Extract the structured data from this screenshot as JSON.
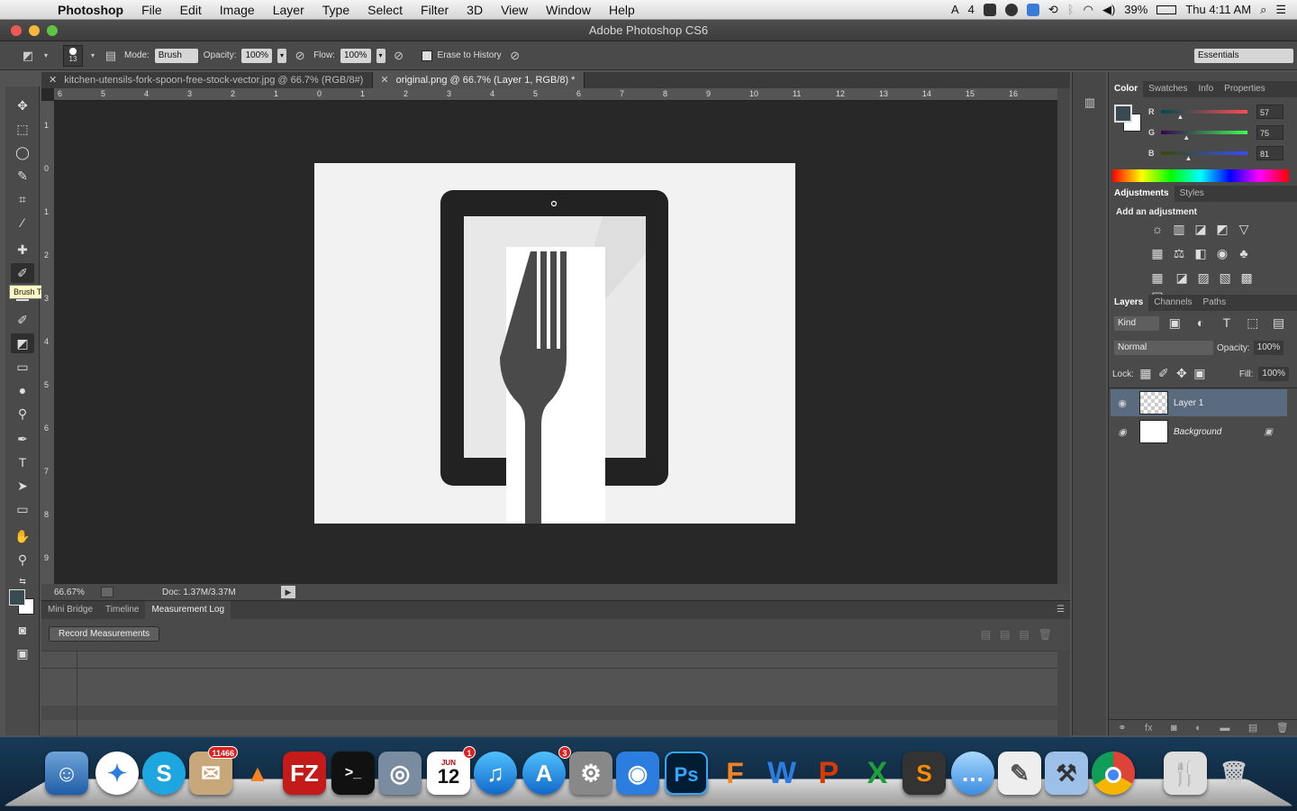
{
  "menubar": {
    "app": "Photoshop",
    "items": [
      "File",
      "Edit",
      "Image",
      "Layer",
      "Type",
      "Select",
      "Filter",
      "3D",
      "View",
      "Window",
      "Help"
    ],
    "status_count": "4",
    "battery": "39%",
    "clock": "Thu 4:11 AM"
  },
  "window": {
    "title": "Adobe Photoshop CS6"
  },
  "options": {
    "brush_size": "13",
    "mode_label": "Mode:",
    "mode_value": "Brush",
    "opacity_label": "Opacity:",
    "opacity_value": "100%",
    "flow_label": "Flow:",
    "flow_value": "100%",
    "erase_history": "Erase to History",
    "workspace": "Essentials"
  },
  "tooltip": "Brush Tool (B)",
  "doc_tabs": [
    {
      "label": "kitchen-utensils-fork-spoon-free-stock-vector.jpg @ 66.7% (RGB/8#)",
      "active": false
    },
    {
      "label": "original.png @ 66.7% (Layer 1, RGB/8) *",
      "active": true
    }
  ],
  "ruler": {
    "h_ticks": [
      "6",
      "5",
      "4",
      "3",
      "2",
      "1",
      "0",
      "1",
      "2",
      "3",
      "4",
      "5",
      "6",
      "7",
      "8",
      "9",
      "10",
      "11",
      "12",
      "13",
      "14",
      "15",
      "16"
    ],
    "v_ticks": [
      "1",
      "0",
      "1",
      "2",
      "3",
      "4",
      "5",
      "6",
      "7",
      "8",
      "9"
    ]
  },
  "status": {
    "zoom": "66.67%",
    "doc": "Doc: 1.37M/3.37M"
  },
  "bottom_panel": {
    "tabs": [
      "Mini Bridge",
      "Timeline",
      "Measurement Log"
    ],
    "active_tab": "Measurement Log",
    "record_button": "Record Measurements"
  },
  "color_panel": {
    "tabs": [
      "Color",
      "Swatches",
      "Info",
      "Properties"
    ],
    "r_label": "R",
    "g_label": "G",
    "b_label": "B",
    "r": "57",
    "g": "75",
    "b": "81",
    "foreground": "#394b51"
  },
  "adjustments": {
    "tabs": [
      "Adjustments",
      "Styles"
    ],
    "heading": "Add an adjustment"
  },
  "layers": {
    "tabs": [
      "Layers",
      "Channels",
      "Paths"
    ],
    "kind": "Kind",
    "blend": "Normal",
    "opacity_label": "Opacity:",
    "opacity": "100%",
    "lock_label": "Lock:",
    "fill_label": "Fill:",
    "fill": "100%",
    "items": [
      {
        "name": "Layer 1",
        "selected": true
      },
      {
        "name": "Background",
        "selected": false
      }
    ]
  },
  "dock": {
    "mail_badge": "11466",
    "calendar_badge": "1",
    "calendar_day": "12",
    "calendar_month": "JUN",
    "appstore_badge": "3"
  }
}
